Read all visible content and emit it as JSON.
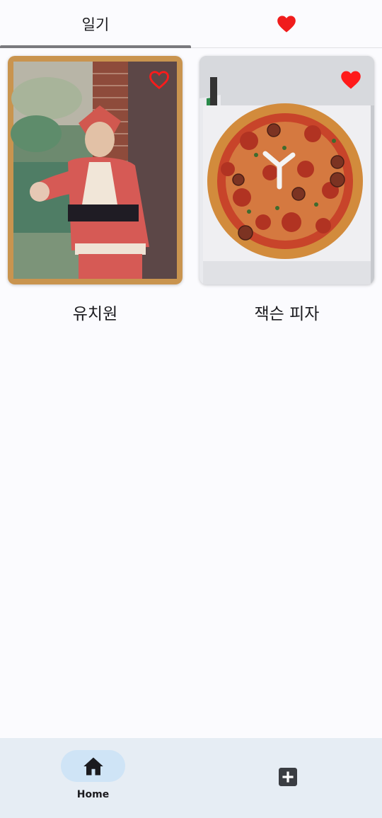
{
  "tabs": [
    {
      "label": "일기",
      "active": true
    },
    {
      "label": "",
      "icon": "heart-icon",
      "active": false
    }
  ],
  "entries": [
    {
      "title": "유치원",
      "favorite": false,
      "image": "child-in-santa-costume-photo"
    },
    {
      "title": "잭슨 피자",
      "favorite": true,
      "image": "pizza-in-box-photo"
    }
  ],
  "bottom_nav": {
    "items": [
      {
        "label": "Home",
        "icon": "home-icon",
        "selected": true
      },
      {
        "label": "",
        "icon": "add-box-icon",
        "selected": false
      }
    ]
  },
  "colors": {
    "background": "#fbfbfe",
    "heart": "#ff1a1a",
    "nav_background": "#e6edf4",
    "nav_pill": "#cfe4f6",
    "tab_indicator": "#7a7a7e"
  }
}
